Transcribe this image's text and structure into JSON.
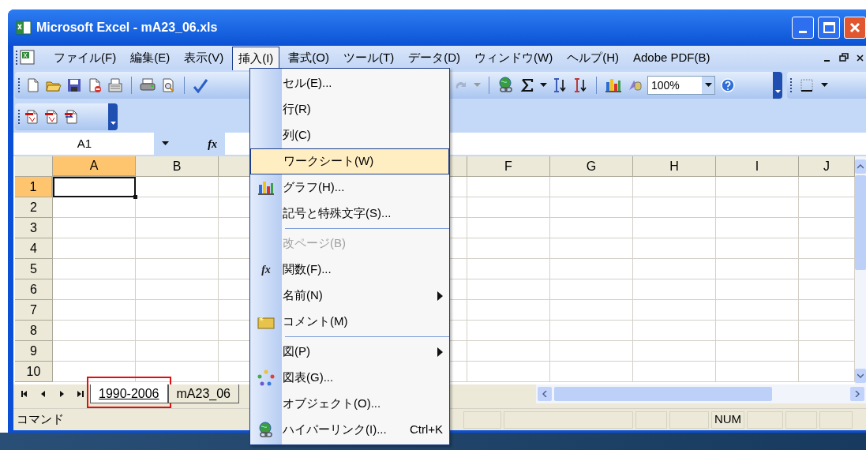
{
  "window": {
    "title": "Microsoft Excel - mA23_06.xls"
  },
  "menu_bar": [
    {
      "label": "ファイル(F)",
      "selected": false
    },
    {
      "label": "編集(E)",
      "selected": false
    },
    {
      "label": "表示(V)",
      "selected": false
    },
    {
      "label": "挿入(I)",
      "selected": true
    },
    {
      "label": "書式(O)",
      "selected": false
    },
    {
      "label": "ツール(T)",
      "selected": false
    },
    {
      "label": "データ(D)",
      "selected": false
    },
    {
      "label": "ウィンドウ(W)",
      "selected": false
    },
    {
      "label": "ヘルプ(H)",
      "selected": false
    },
    {
      "label": "Adobe PDF(B)",
      "selected": false
    }
  ],
  "toolbar": {
    "zoom": "100%"
  },
  "formula_bar": {
    "name_box": "A1",
    "fx": "fx"
  },
  "columns": [
    {
      "label": "A",
      "selected": true
    },
    {
      "label": "B",
      "selected": false
    },
    {
      "label": "F",
      "selected": false
    },
    {
      "label": "G",
      "selected": false
    },
    {
      "label": "H",
      "selected": false
    },
    {
      "label": "I",
      "selected": false
    },
    {
      "label": "J",
      "selected": false
    }
  ],
  "rows": [
    {
      "label": "1",
      "selected": true
    },
    {
      "label": "2",
      "selected": false
    },
    {
      "label": "3",
      "selected": false
    },
    {
      "label": "4",
      "selected": false
    },
    {
      "label": "5",
      "selected": false
    },
    {
      "label": "6",
      "selected": false
    },
    {
      "label": "7",
      "selected": false
    },
    {
      "label": "8",
      "selected": false
    },
    {
      "label": "9",
      "selected": false
    },
    {
      "label": "10",
      "selected": false
    }
  ],
  "sheet_tabs": [
    {
      "label": "1990-2006",
      "selected": true,
      "highlighted": true
    },
    {
      "label": "mA23_06",
      "selected": false,
      "highlighted": false
    }
  ],
  "status_bar": {
    "mode": "コマンド",
    "num_lock": "NUM"
  },
  "insert_menu": [
    {
      "kind": "item",
      "label": "セル(E)...",
      "disabled": false,
      "selected": false,
      "submenu": false
    },
    {
      "kind": "item",
      "label": "行(R)",
      "disabled": false,
      "selected": false,
      "submenu": false
    },
    {
      "kind": "item",
      "label": "列(C)",
      "disabled": false,
      "selected": false,
      "submenu": false
    },
    {
      "kind": "item",
      "label": "ワークシート(W)",
      "disabled": false,
      "selected": true,
      "submenu": false
    },
    {
      "kind": "item",
      "label": "グラフ(H)...",
      "disabled": false,
      "selected": false,
      "submenu": false
    },
    {
      "kind": "item",
      "label": "記号と特殊文字(S)...",
      "disabled": false,
      "selected": false,
      "submenu": false
    },
    {
      "kind": "separator"
    },
    {
      "kind": "item",
      "label": "改ページ(B)",
      "disabled": true,
      "selected": false,
      "submenu": false
    },
    {
      "kind": "item",
      "label": "関数(F)...",
      "icon_text": "fx",
      "disabled": false,
      "selected": false,
      "submenu": false
    },
    {
      "kind": "item",
      "label": "名前(N)",
      "disabled": false,
      "selected": false,
      "submenu": true
    },
    {
      "kind": "item",
      "label": "コメント(M)",
      "disabled": false,
      "selected": false,
      "submenu": false
    },
    {
      "kind": "separator"
    },
    {
      "kind": "item",
      "label": "図(P)",
      "disabled": false,
      "selected": false,
      "submenu": true
    },
    {
      "kind": "item",
      "label": "図表(G)...",
      "disabled": false,
      "selected": false,
      "submenu": false
    },
    {
      "kind": "item",
      "label": "オブジェクト(O)...",
      "disabled": false,
      "selected": false,
      "submenu": false
    },
    {
      "kind": "item",
      "label": "ハイパーリンク(I)...",
      "shortcut": "Ctrl+K",
      "disabled": false,
      "selected": false,
      "submenu": false
    }
  ]
}
